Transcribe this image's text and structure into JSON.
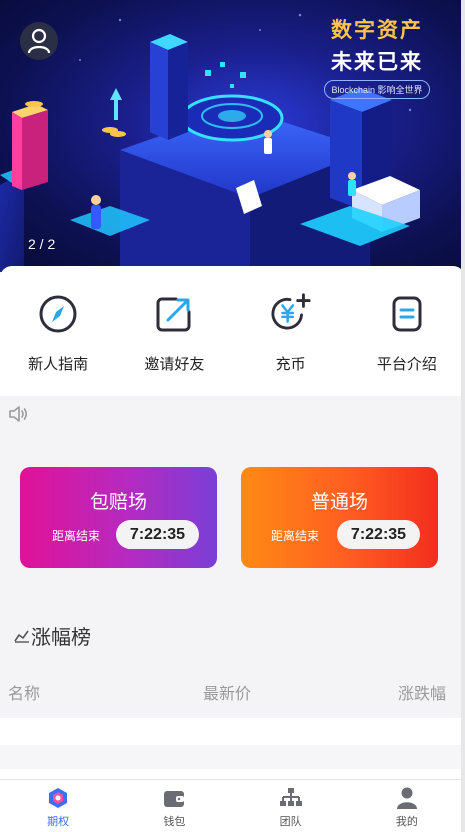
{
  "banner": {
    "slogan_line1": "数字资产",
    "slogan_line2": "未来已来",
    "slogan_tag": "Blockchain 影响全世界",
    "pager": "2 / 2",
    "avatar_icon": "user-icon"
  },
  "quick_actions": [
    {
      "label": "新人指南",
      "icon": "compass-icon"
    },
    {
      "label": "邀请好友",
      "icon": "share-arrow-icon"
    },
    {
      "label": "充币",
      "icon": "yen-plus-icon"
    },
    {
      "label": "平台介绍",
      "icon": "document-icon"
    }
  ],
  "notice": {
    "icon": "speaker-icon"
  },
  "sessions": [
    {
      "title": "包赔场",
      "sub": "距离结束",
      "timer": "7:22:35",
      "colors": [
        "#e01298",
        "#7a3fd6"
      ]
    },
    {
      "title": "普通场",
      "sub": "距离结束",
      "timer": "7:22:35",
      "colors": [
        "#ff8a14",
        "#f22e1d"
      ]
    }
  ],
  "ranking": {
    "title": "涨幅榜",
    "icon": "chart-icon",
    "columns": [
      "名称",
      "最新价",
      "涨跌幅"
    ]
  },
  "tabbar": [
    {
      "label": "期权",
      "icon": "home-hex-icon",
      "active": true
    },
    {
      "label": "钱包",
      "icon": "wallet-icon",
      "active": false
    },
    {
      "label": "团队",
      "icon": "team-icon",
      "active": false
    },
    {
      "label": "我的",
      "icon": "profile-icon",
      "active": false
    }
  ],
  "accent_color": "#3a6ff7"
}
